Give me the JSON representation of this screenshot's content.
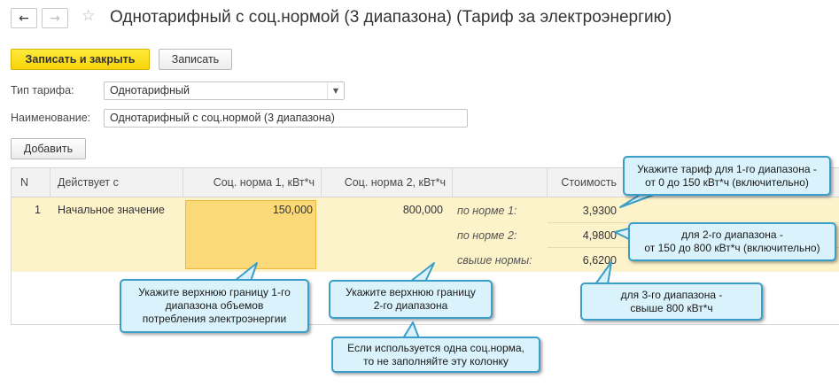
{
  "window": {
    "title": "Однотарифный с соц.нормой (3 диапазона) (Тариф за электроэнергию)",
    "back_icon": "←",
    "forward_icon": "→",
    "favorite_icon": "☆"
  },
  "toolbar": {
    "save_close_label": "Записать и закрыть",
    "save_label": "Записать"
  },
  "form": {
    "tariff_type_label": "Тип тарифа:",
    "tariff_type_value": "Однотарифный",
    "tariff_type_dropdown_icon": "▼",
    "name_label": "Наименование:",
    "name_value": "Однотарифный с соц.нормой (3 диапазона)"
  },
  "table": {
    "add_label": "Добавить",
    "columns": {
      "n": "N",
      "valid_from": "Действует с",
      "norm1": "Соц. норма 1, кВт*ч",
      "norm2": "Соц. норма 2, кВт*ч",
      "cost": "Стоимость"
    },
    "row": {
      "n": "1",
      "valid_from": "Начальное значение",
      "norm1": "150,000",
      "norm2": "800,000",
      "ranges": [
        {
          "label": "по норме 1:",
          "cost": "3,9300"
        },
        {
          "label": "по норме 2:",
          "cost": "4,9800"
        },
        {
          "label": "свыше нормы:",
          "cost": "6,6200"
        }
      ]
    }
  },
  "callouts": {
    "range1": [
      "Укажите тариф для 1-го диапазона -",
      "от 0 до 150 кВт*ч (включительно)"
    ],
    "range2": [
      "для 2-го диапазона -",
      "от 150 до 800 кВт*ч (включительно)"
    ],
    "range3": [
      "для 3-го диапазона -",
      "свыше 800 кВт*ч"
    ],
    "norm1": [
      "Укажите верхнюю границу 1-го",
      "диапазона объемов",
      "потребления электроэнергии"
    ],
    "norm2": [
      "Укажите верхнюю границу",
      "2-го диапазона"
    ],
    "single": [
      "Если используется одна соц.норма,",
      "то не заполняйте эту колонку"
    ]
  },
  "colors": {
    "primary_button": "#f7d40a",
    "row_highlight": "#fcf3cb",
    "selected_cell": "#fbd978",
    "callout_fill": "#d9f2fb",
    "callout_border": "#3a9ec8"
  }
}
